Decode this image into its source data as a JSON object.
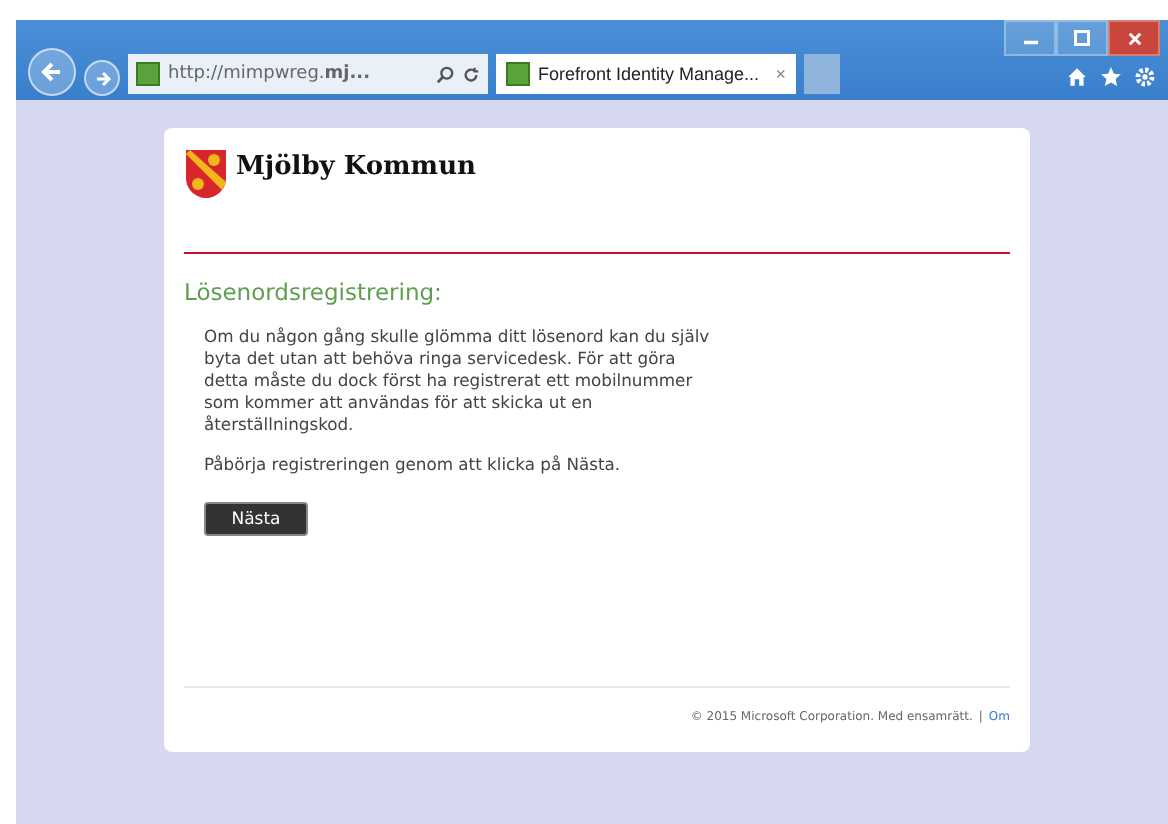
{
  "browser": {
    "address": "http://mimpwreg.**mj...**",
    "tabs": [
      {
        "label": "Forefront Identity Manage...",
        "selected": true,
        "close": "×"
      }
    ]
  },
  "page": {
    "logo_text": "Mjölby Kommun",
    "heading": "Lösenordsregistrering:",
    "paragraphs": [
      "Om du någon gång skulle glömma ditt lösenord kan du själv byta det utan att behöva ringa servicedesk. För att göra detta måste du dock först ha registrerat ett mobilnummer som kommer att användas för att skicka ut en återställningskod.",
      "Påbörja registreringen genom att klicka på Nästa."
    ],
    "button": "Nästa",
    "footer": {
      "copyright": "© 2015 Microsoft Corporation. Med ensamrätt.",
      "separator": "|",
      "link": "Om"
    }
  }
}
